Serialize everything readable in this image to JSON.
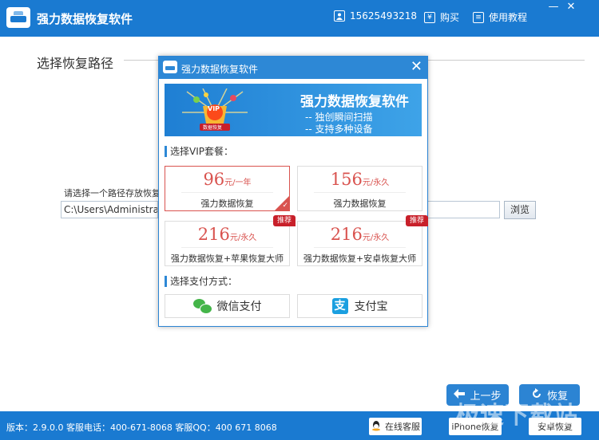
{
  "app": {
    "title": "强力数据恢复软件",
    "phone": "15625493218",
    "buy_label": "购买",
    "tutorial_label": "使用教程",
    "minimize": "—",
    "close": "✕"
  },
  "main": {
    "section_title": "选择恢复路径",
    "path_label": "请选择一个路径存放恢复",
    "path_value": "C:\\Users\\Administrato",
    "browse_label": "浏览",
    "back_label": "上一步",
    "recover_label": "恢复"
  },
  "statusbar": {
    "info": "版本：2.9.0.0  客服电话：400-671-8068   客服QQ：400 671 8068",
    "online_service": "在线客服",
    "iphone_recover": "iPhone恢复",
    "android_recover": "安卓恢复",
    "watermark": "极速下载站"
  },
  "modal": {
    "title": "强力数据恢复软件",
    "banner_title": "强力数据恢复软件",
    "banner_line1": "-- 独创瞬间扫描",
    "banner_line2": "-- 支持多种设备",
    "badge_text": "VIP",
    "badge_sub": "数据恢复",
    "vip_heading": "选择VIP套餐：",
    "pay_heading": "选择支付方式：",
    "packages": [
      {
        "price": "96",
        "unit": "元/一年",
        "name": "强力数据恢复",
        "selected": true,
        "tag": ""
      },
      {
        "price": "156",
        "unit": "元/永久",
        "name": "强力数据恢复",
        "selected": false,
        "tag": ""
      },
      {
        "price": "216",
        "unit": "元/永久",
        "name": "强力数据恢复+苹果恢复大师",
        "selected": false,
        "tag": "推荐"
      },
      {
        "price": "216",
        "unit": "元/永久",
        "name": "强力数据恢复+安卓恢复大师",
        "selected": false,
        "tag": "推荐"
      }
    ],
    "payments": [
      {
        "label": "微信支付",
        "icon": "wechat-icon"
      },
      {
        "label": "支付宝",
        "icon": "alipay-icon"
      }
    ]
  },
  "colors": {
    "brand_blue": "#1a7ad1",
    "price_red": "#d9534f",
    "tag_red": "#c8202a",
    "wechat_green": "#44b549",
    "alipay_blue": "#1a9fe0"
  }
}
